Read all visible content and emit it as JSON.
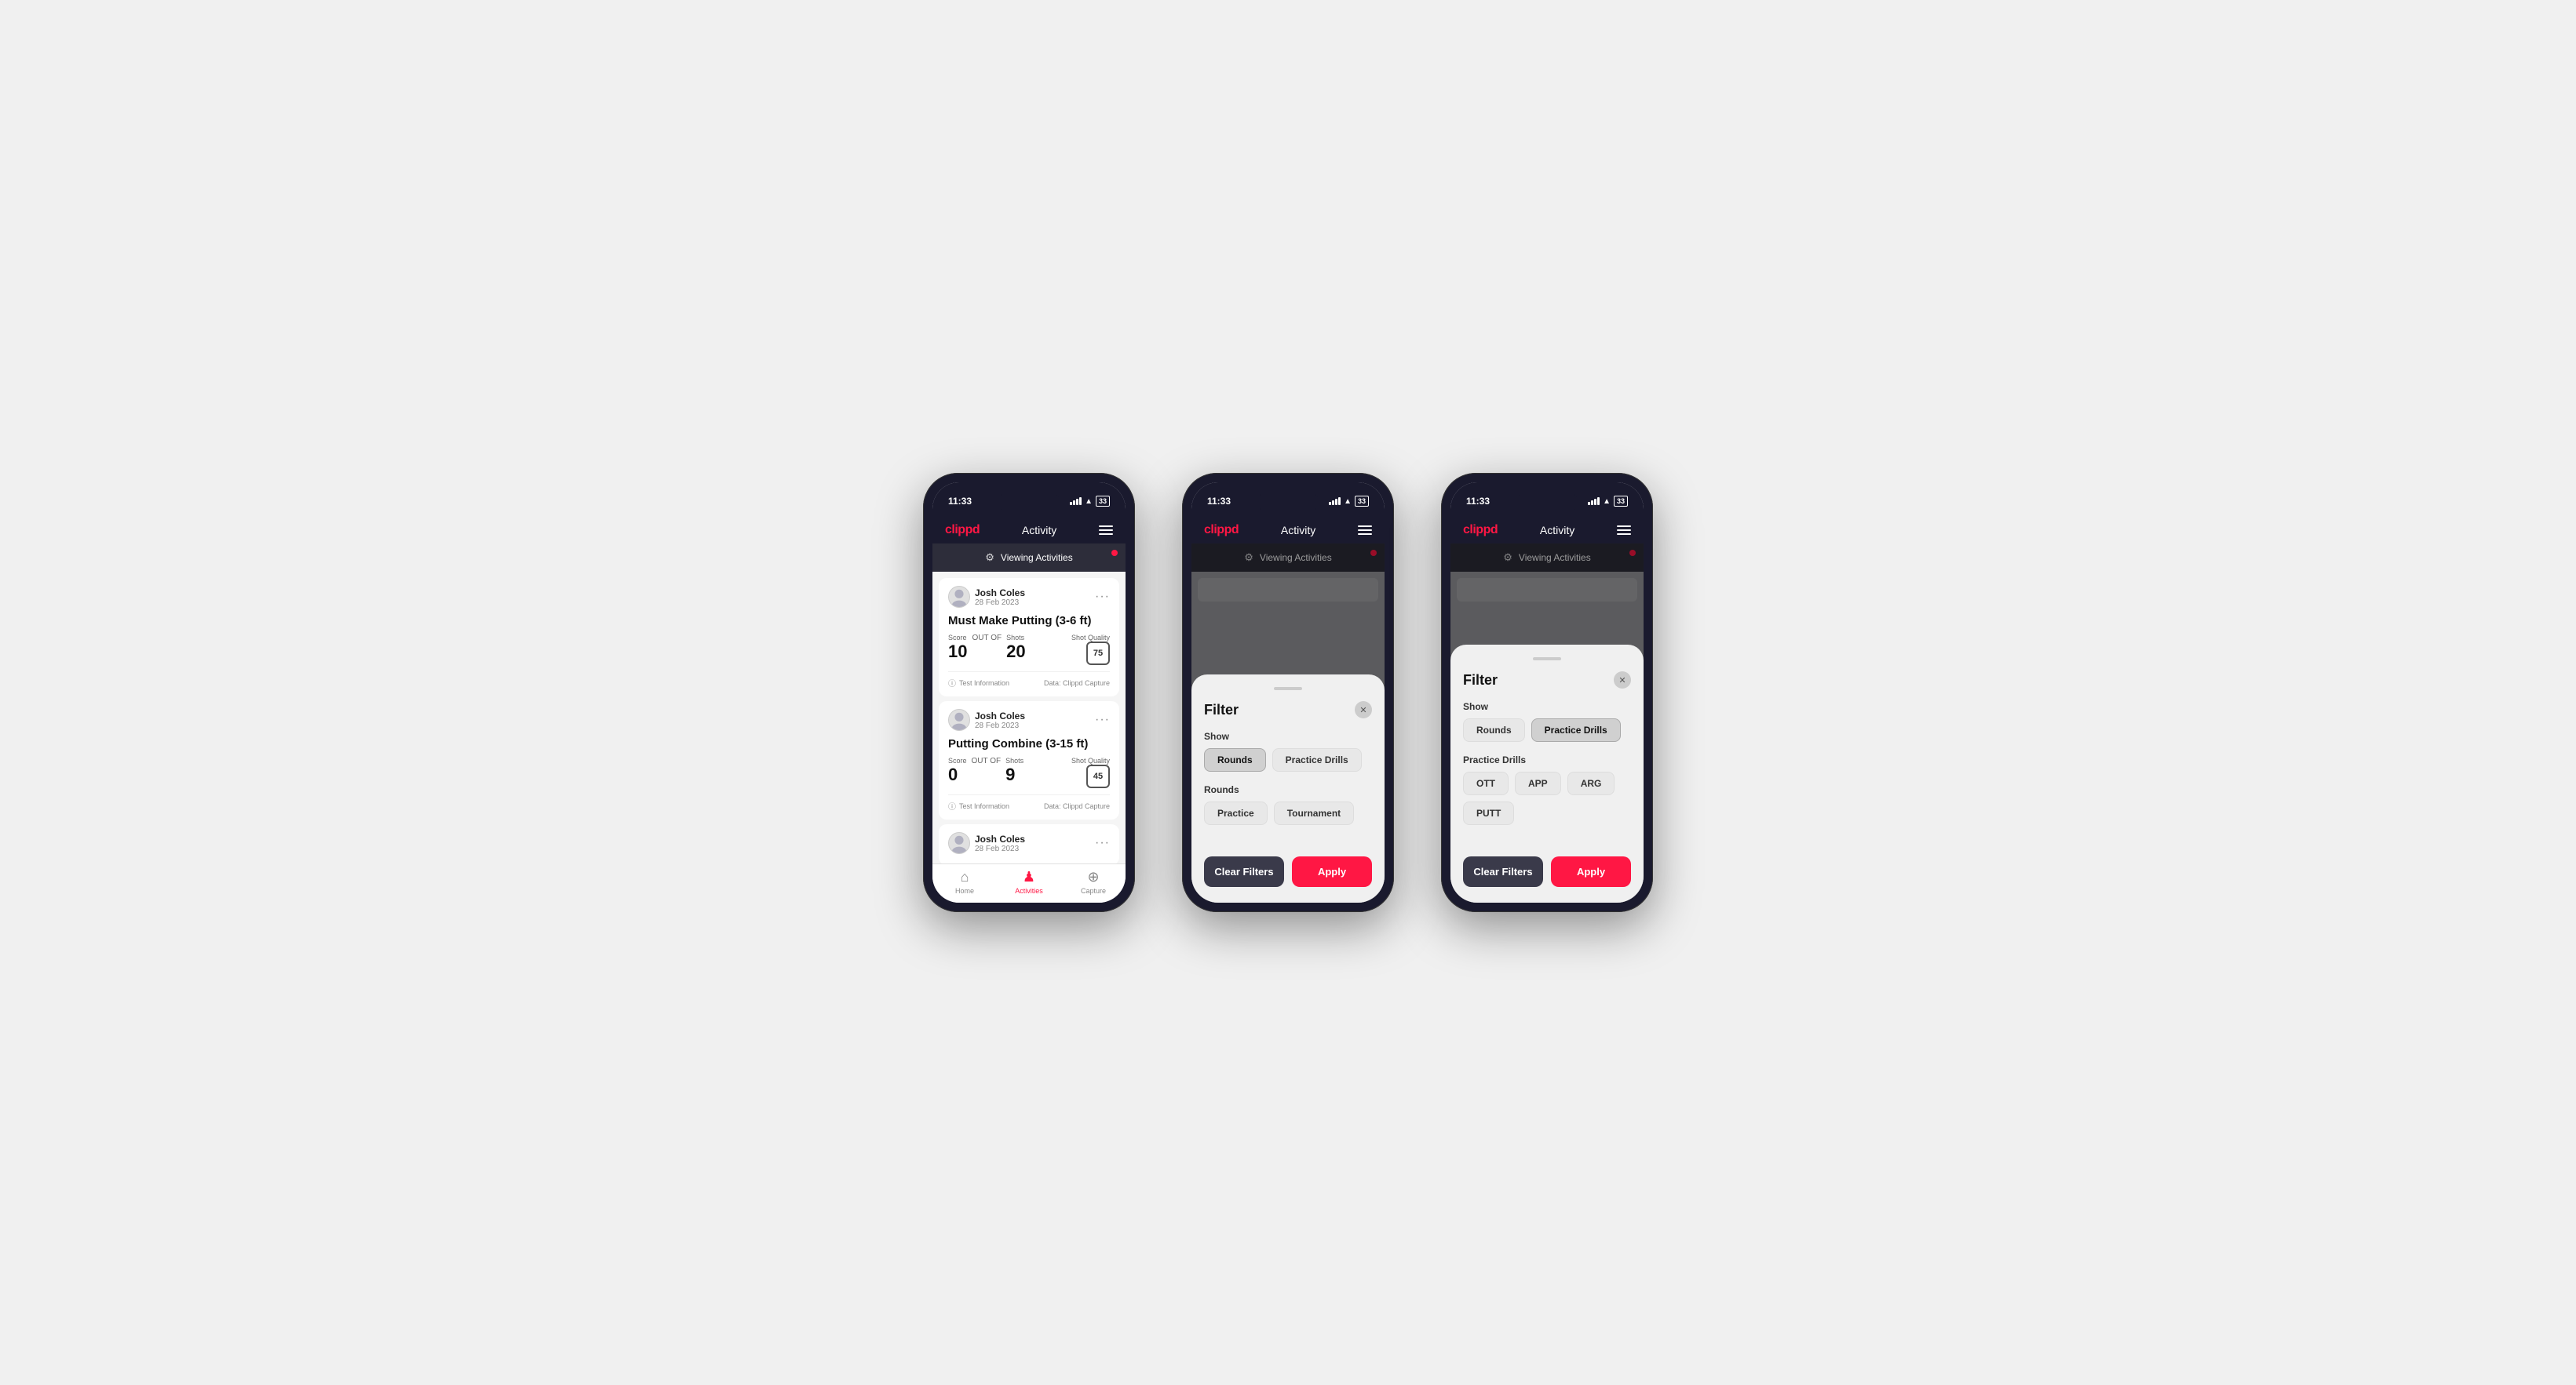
{
  "app": {
    "logo": "clippd",
    "nav_title": "Activity",
    "time": "11:33"
  },
  "phone1": {
    "viewing_label": "Viewing Activities",
    "cards": [
      {
        "user_name": "Josh Coles",
        "user_date": "28 Feb 2023",
        "title": "Must Make Putting (3-6 ft)",
        "score_label": "Score",
        "score": "10",
        "out_of_label": "OUT OF",
        "shots_label": "Shots",
        "shots": "20",
        "shot_quality_label": "Shot Quality",
        "shot_quality": "75",
        "info_label": "Test Information",
        "data_label": "Data: Clippd Capture"
      },
      {
        "user_name": "Josh Coles",
        "user_date": "28 Feb 2023",
        "title": "Putting Combine (3-15 ft)",
        "score_label": "Score",
        "score": "0",
        "out_of_label": "OUT OF",
        "shots_label": "Shots",
        "shots": "9",
        "shot_quality_label": "Shot Quality",
        "shot_quality": "45",
        "info_label": "Test Information",
        "data_label": "Data: Clippd Capture"
      }
    ],
    "tab_home": "Home",
    "tab_activities": "Activities",
    "tab_capture": "Capture"
  },
  "phone2": {
    "viewing_label": "Viewing Activities",
    "filter_title": "Filter",
    "show_label": "Show",
    "rounds_btn": "Rounds",
    "practice_drills_btn": "Practice Drills",
    "rounds_section_label": "Rounds",
    "practice_btn": "Practice",
    "tournament_btn": "Tournament",
    "clear_filters_btn": "Clear Filters",
    "apply_btn": "Apply"
  },
  "phone3": {
    "viewing_label": "Viewing Activities",
    "filter_title": "Filter",
    "show_label": "Show",
    "rounds_btn": "Rounds",
    "practice_drills_btn": "Practice Drills",
    "practice_drills_section_label": "Practice Drills",
    "ott_btn": "OTT",
    "app_btn": "APP",
    "arg_btn": "ARG",
    "putt_btn": "PUTT",
    "clear_filters_btn": "Clear Filters",
    "apply_btn": "Apply"
  }
}
